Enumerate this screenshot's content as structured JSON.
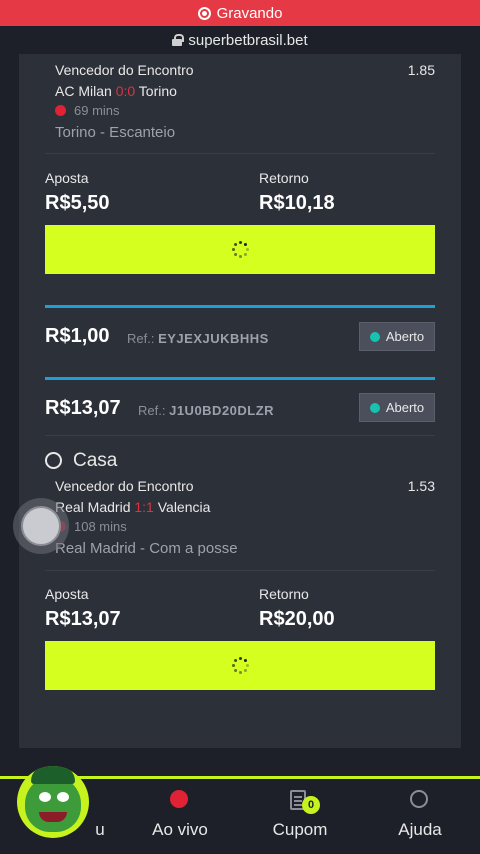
{
  "recording": {
    "label": "Gravando"
  },
  "browser": {
    "url": "superbetbrasil.bet"
  },
  "bet1": {
    "market": "Vencedor do Encontro",
    "odds": "1.85",
    "home": "AC Milan",
    "score": "0:0",
    "away": "Torino",
    "time": "69 mins",
    "pick": "Torino - Escanteio",
    "stake_label": "Aposta",
    "stake": "R$5,50",
    "return_label": "Retorno",
    "return": "R$10,18"
  },
  "ticket1": {
    "amount": "R$1,00",
    "ref_label": "Ref.:",
    "ref": "EYJEXJUKBHHS",
    "status": "Aberto"
  },
  "ticket2": {
    "amount": "R$13,07",
    "ref_label": "Ref.:",
    "ref": "J1U0BD20DLZR",
    "status": "Aberto"
  },
  "bet2": {
    "option": "Casa",
    "market": "Vencedor do Encontro",
    "odds": "1.53",
    "home": "Real Madrid",
    "score": "1:1",
    "away": "Valencia",
    "time": "108 mins",
    "pick": "Real Madrid - Com a posse",
    "stake_label": "Aposta",
    "stake": "R$13,07",
    "return_label": "Retorno",
    "return": "R$20,00"
  },
  "nav": {
    "items": [
      {
        "label": "u",
        "icon": "mascot-icon"
      },
      {
        "label": "Ao vivo",
        "icon": "live-dot-icon"
      },
      {
        "label": "Cupom",
        "icon": "coupon-icon",
        "badge": "0"
      },
      {
        "label": "Ajuda",
        "icon": "whatsapp-icon"
      }
    ]
  },
  "colors": {
    "accent": "#d4ff1f",
    "live": "#e02234",
    "divider": "#1f9fd9",
    "open": "#16c3b0"
  }
}
